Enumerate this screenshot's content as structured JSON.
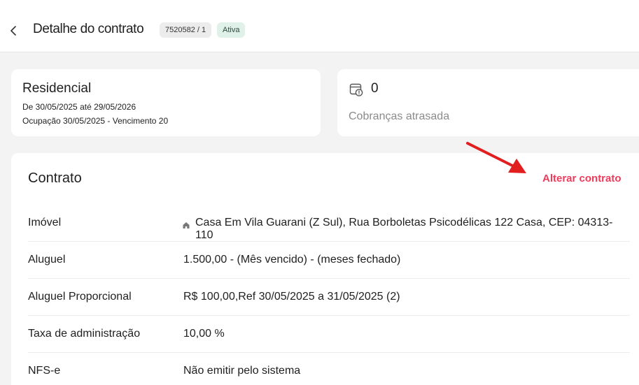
{
  "header": {
    "title": "Detalhe do contrato",
    "contract_id": "7520582 / 1",
    "status": "Ativa"
  },
  "summary": {
    "type": "Residencial",
    "period": "De 30/05/2025 até 29/05/2026",
    "occupation": "Ocupação 30/05/2025 - Vencimento 20"
  },
  "late_charges": {
    "count": "0",
    "label": "Cobranças atrasada",
    "icon": "calendar-clock-icon"
  },
  "contract": {
    "title": "Contrato",
    "edit_label": "Alterar contrato",
    "rows": [
      {
        "label": "Imóvel",
        "value": "Casa Em Vila Guarani (Z Sul), Rua Borboletas Psicodélicas 122 Casa, CEP: 04313-110"
      },
      {
        "label": "Aluguel",
        "value": "1.500,00 - (Mês vencido) - (meses fechado)"
      },
      {
        "label": "Aluguel Proporcional",
        "value": "R$ 100,00,Ref 30/05/2025 a 31/05/2025 (2)"
      },
      {
        "label": "Taxa de administração",
        "value": "10,00 %"
      },
      {
        "label": "NFS-e",
        "value": "Não emitir pelo sistema"
      }
    ]
  },
  "colors": {
    "accent": "#ee3b5b",
    "annotation_arrow": "#e11f1f",
    "status_bg": "#dff1e8"
  }
}
